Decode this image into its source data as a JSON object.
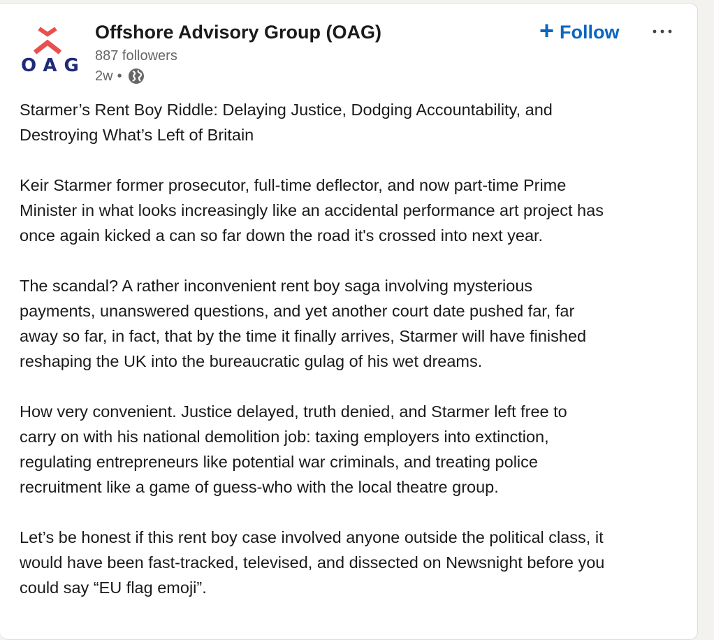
{
  "post": {
    "author": {
      "name": "Offshore Advisory Group (OAG)",
      "logo_text": "OAG",
      "followers": "887 followers",
      "time": "2w",
      "separator": "•",
      "visibility_icon": "globe-icon"
    },
    "follow_label": "Follow",
    "follow_plus": "+",
    "more_icon": "ellipsis-icon",
    "paragraphs": [
      "Starmer’s Rent Boy Riddle: Delaying Justice, Dodging Accountability, and\nDestroying What’s Left of Britain",
      "Keir Starmer former prosecutor, full-time deflector, and now part-time Prime\nMinister in what looks increasingly like an accidental performance art project has\nonce again kicked a can so far down the road it's crossed into next year.",
      "The scandal? A rather inconvenient rent boy saga involving mysterious\npayments, unanswered questions, and yet another court date pushed far, far\naway so far, in fact, that by the time it finally arrives, Starmer will have finished\nreshaping the UK into the bureaucratic gulag of his wet dreams.",
      "How very convenient. Justice delayed, truth denied, and Starmer left free to\ncarry on with his national demolition job: taxing employers into extinction,\nregulating entrepreneurs like potential war criminals, and treating police\nrecruitment like a game of guess-who with the local theatre group.",
      "Let’s be honest if this rent boy case involved anyone outside the political class, it\nwould have been fast-tracked, televised, and dissected on Newsnight before you\ncould say “EU flag emoji”."
    ]
  },
  "colors": {
    "link_blue": "#0a66c2",
    "logo_navy": "#1f2a78",
    "logo_red": "#e8504f",
    "meta_gray": "#666666"
  }
}
